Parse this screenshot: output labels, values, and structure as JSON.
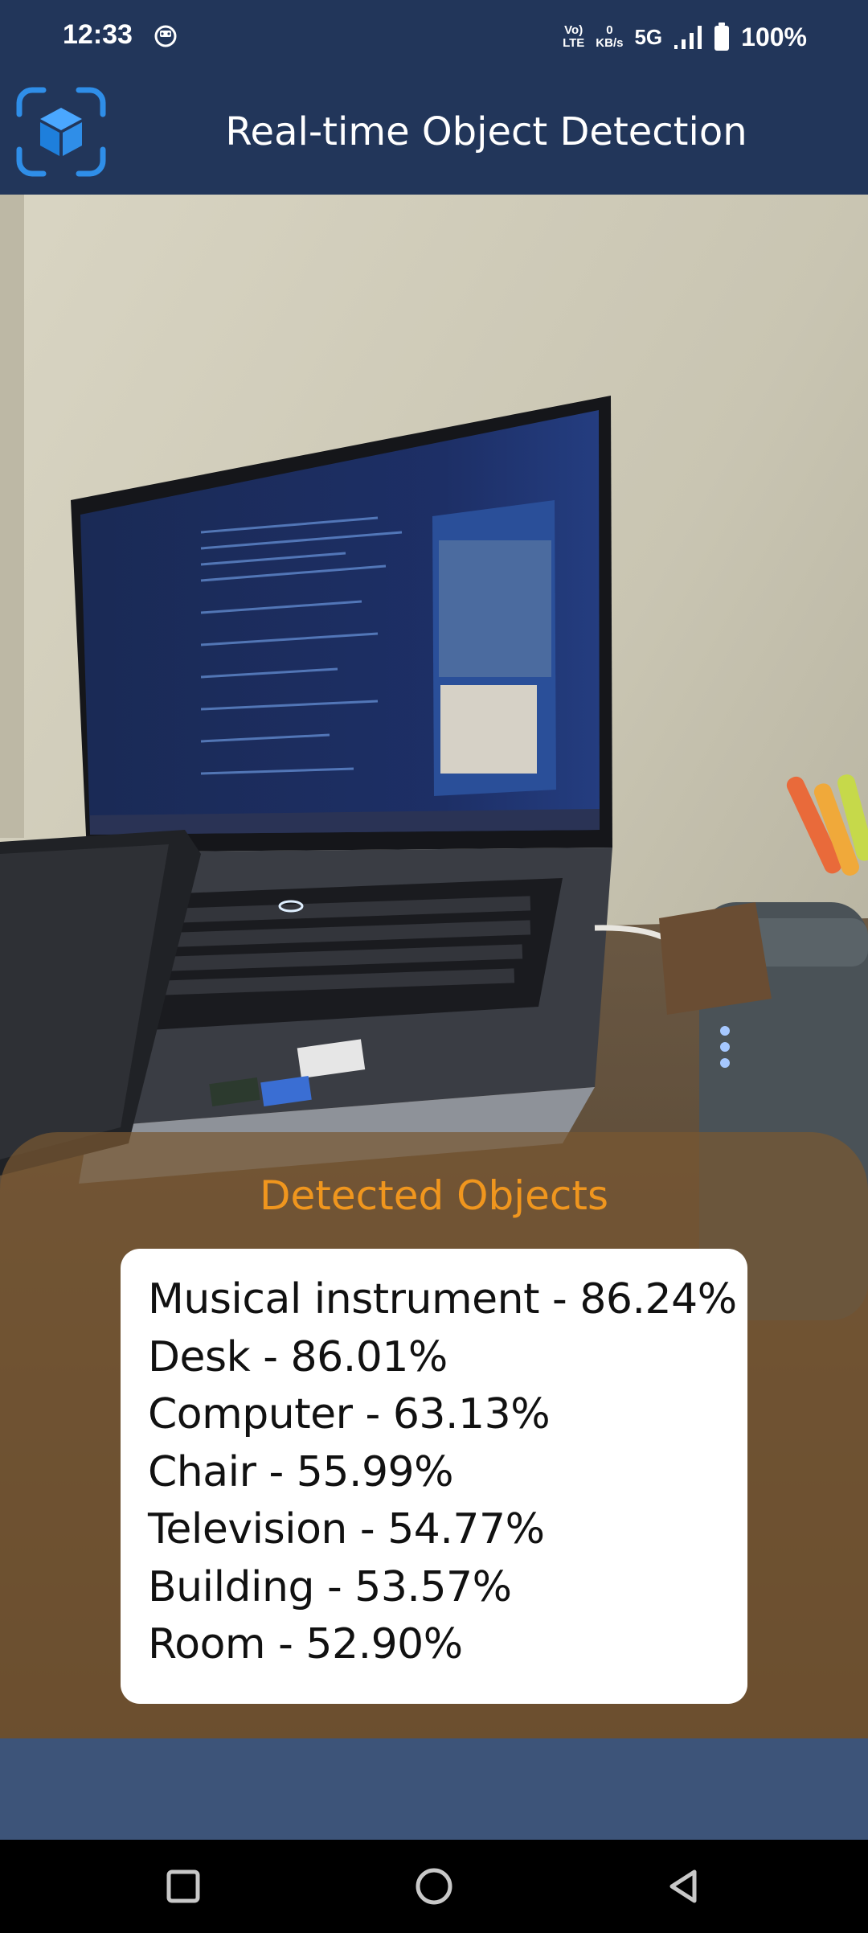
{
  "status_bar": {
    "time": "12:33",
    "volte_top": "Vo)",
    "volte_bottom": "LTE",
    "speed_value": "0",
    "speed_unit": "KB/s",
    "network": "5G",
    "battery": "100%"
  },
  "app_bar": {
    "title": "Real-time Object Detection",
    "logo_icon": "cube-scan-icon",
    "accent_color": "#2f8ee8"
  },
  "camera_view": {
    "icon": "camera-preview-image"
  },
  "detected_panel": {
    "title": "Detected Objects",
    "title_color": "#f0961e",
    "items": [
      {
        "text": "Musical instrument - 86.24%"
      },
      {
        "text": "Desk - 86.01%"
      },
      {
        "text": "Computer - 63.13%"
      },
      {
        "text": "Chair - 55.99%"
      },
      {
        "text": "Television - 54.77%"
      },
      {
        "text": "Building - 53.57%"
      },
      {
        "text": "Room - 52.90%"
      }
    ]
  },
  "nav_bar": {
    "recents_icon": "square-icon",
    "home_icon": "circle-icon",
    "back_icon": "triangle-back-icon"
  }
}
